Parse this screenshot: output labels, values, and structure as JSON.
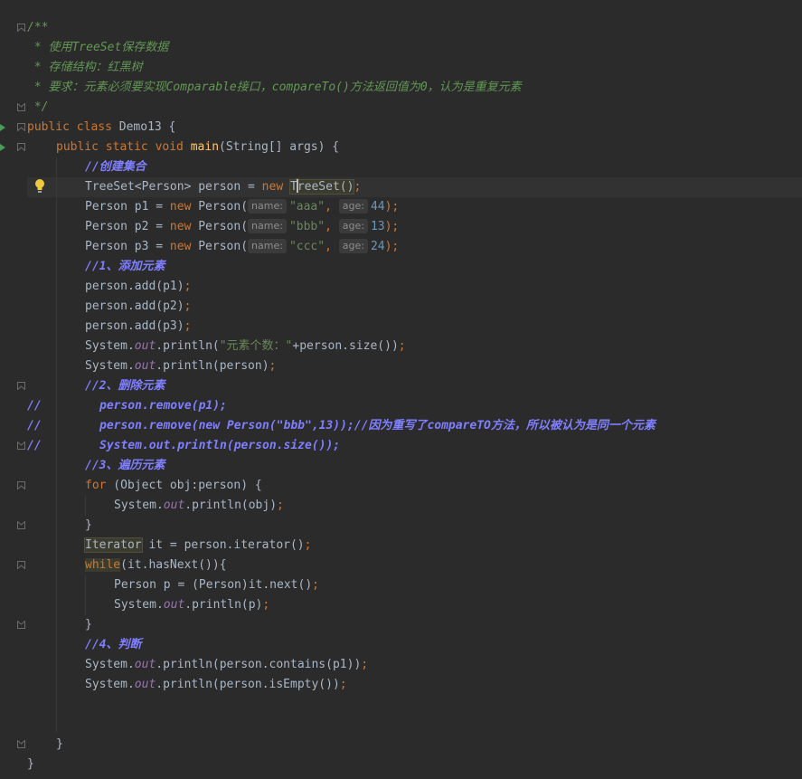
{
  "editor": {
    "line_comment_prefix": "//",
    "lines": {
      "l1": "/**",
      "l2": " * 使用TreeSet保存数据",
      "l3": " * 存储结构：红黑树",
      "l4": " * 要求：元素必须要实现Comparable接口，compareTo()方法返回值为0，认为是重复元素",
      "l5": " */",
      "l6_kw1": "public",
      "l6_kw2": "class",
      "l6_rest": " Demo13 {",
      "l7_kw": "public static void",
      "l7_fn": "main",
      "l7_rest": "(String[] args) {",
      "l8": "//创建集合",
      "l9_a": "TreeSet<Person> person = ",
      "l9_new": "new",
      "l9_t": "T",
      "l9_b": "reeSet()",
      "l9_semi": ";",
      "p1_a": "Person p1 = ",
      "p1_str": "\"aaa\"",
      "p1_num": "44",
      "p2_a": "Person p2 = ",
      "p2_str": "\"bbb\"",
      "p2_num": "13",
      "p3_a": "Person p3 = ",
      "p3_str": "\"ccc\"",
      "p3_num": "24",
      "new_kw": "new",
      "person_ctor": " Person(",
      "hint_name": "name:",
      "hint_age": "age:",
      "comma": ",",
      "close_semi": ");",
      "c_add": "//1、添加元素",
      "add1": "person.add(p1)",
      "add2": "person.add(p2)",
      "add3": "person.add(p3)",
      "semi": ";",
      "sys": "System.",
      "out": "out",
      "println_open": ".println(",
      "size_str": "\"元素个数：\"",
      "size_rest": "+person.size())",
      "print_person": "person)",
      "c_del": "//2、删除元素",
      "del1": "person.remove(p1);",
      "del2": "person.remove(new Person(\"bbb\",13));//因为重写了compareTO方法，所以被认为是同一个元素",
      "del3": "System.out.println(person.size());",
      "c_iter": "//3、遍历元素",
      "for_kw": "for",
      "for_rest": " (Object obj:person) {",
      "print_obj": "obj)",
      "brace_close": "}",
      "iter_type": "Iterator",
      "iter_rest": " it = person.iterator()",
      "while_kw": "while",
      "while_rest": "(it.hasNext()){",
      "person_p": "Person p = (Person)it.next()",
      "print_p": "p)",
      "c_judge": "//4、判断",
      "contains": "person.contains(p1))",
      "isempty": "person.isEmpty())",
      "end_brace": "}"
    }
  }
}
